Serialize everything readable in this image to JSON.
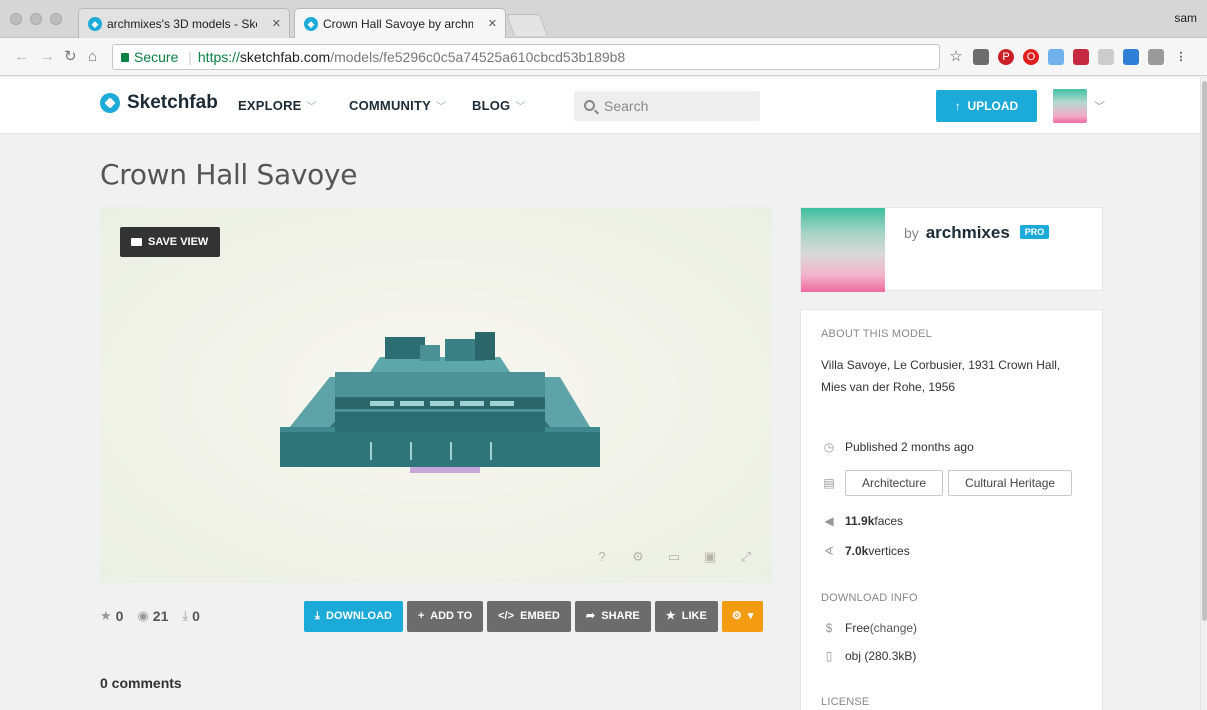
{
  "browser": {
    "tabs": [
      {
        "label": "archmixes's 3D models - Sketc",
        "active": false
      },
      {
        "label": "Crown Hall Savoye by archmix",
        "active": true
      }
    ],
    "profile": "sam",
    "url": {
      "secure_label": "Secure",
      "scheme": "https://",
      "host": "sketchfab.com",
      "path": "/models/fe5296c0c5a74525a610cbcd53b189b8"
    }
  },
  "site": {
    "logo": "Sketchfab",
    "nav": [
      {
        "label": "EXPLORE"
      },
      {
        "label": "COMMUNITY"
      },
      {
        "label": "BLOG"
      }
    ],
    "search_placeholder": "Search",
    "upload_label": "UPLOAD"
  },
  "model": {
    "title": "Crown Hall Savoye",
    "save_view": "SAVE VIEW",
    "stats": {
      "likes": "0",
      "views": "21",
      "downloads": "0"
    },
    "actions": {
      "download": "DOWNLOAD",
      "add_to": "ADD TO",
      "embed": "EMBED",
      "share": "SHARE",
      "like": "LIKE"
    },
    "comments": "0 comments"
  },
  "author": {
    "by": "by",
    "name": "archmixes",
    "badge": "PRO"
  },
  "about": {
    "title": "ABOUT THIS MODEL",
    "description": "Villa Savoye, Le Corbusier, 1931 Crown Hall, Mies van der Rohe, 1956",
    "published": "Published 2 months ago",
    "categories": [
      "Architecture",
      "Cultural Heritage"
    ],
    "faces_value": "11.9k",
    "faces_label": " faces",
    "vertices_value": "7.0k",
    "vertices_label": " vertices",
    "download_title": "DOWNLOAD INFO",
    "price": "Free",
    "change": " (change)",
    "format": "obj (280.3kB)",
    "license_title": "LICENSE"
  },
  "colors": {
    "accent": "#1caad9",
    "orange": "#f39c12",
    "gray_button": "#6c6c6c",
    "secure": "#0b8043"
  }
}
